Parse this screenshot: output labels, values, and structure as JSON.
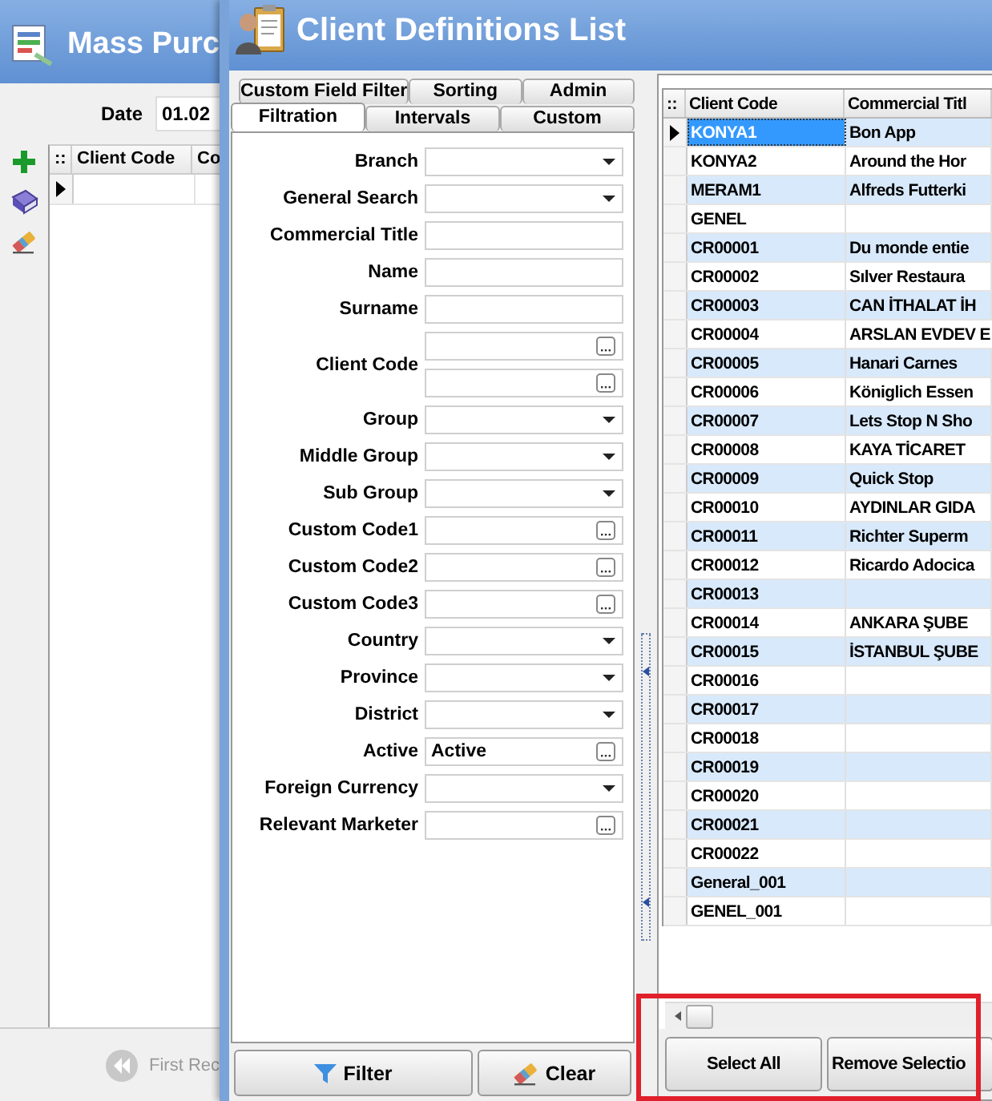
{
  "background_window": {
    "title": "Mass Purc",
    "date_label": "Date",
    "date_value": "01.02",
    "table": {
      "columns": [
        "::",
        "Client Code",
        "Co"
      ]
    },
    "status_bar": {
      "first_record": "First Rec",
      "disabled": true
    }
  },
  "window": {
    "title": "Client Definitions List"
  },
  "filter_tabs": {
    "top_row": [
      {
        "label": "Custom Field Filter",
        "selected": false
      },
      {
        "label": "Sorting",
        "selected": false
      },
      {
        "label": "Admin",
        "selected": false
      }
    ],
    "bottom_row": [
      {
        "label": "Filtration",
        "selected": true
      },
      {
        "label": "Intervals",
        "selected": false
      },
      {
        "label": "Custom",
        "selected": false
      }
    ]
  },
  "filter_fields": [
    {
      "label": "Branch",
      "kind": "dropdown"
    },
    {
      "label": "General Search",
      "kind": "dropdown"
    },
    {
      "label": "Commercial Title",
      "kind": "text"
    },
    {
      "label": "Name",
      "kind": "text"
    },
    {
      "label": "Surname",
      "kind": "text"
    },
    {
      "label": "Client Code",
      "kind": "lookup-range"
    },
    {
      "label": "Group",
      "kind": "dropdown"
    },
    {
      "label": "Middle Group",
      "kind": "dropdown"
    },
    {
      "label": "Sub Group",
      "kind": "dropdown"
    },
    {
      "label": "Custom Code1",
      "kind": "lookup"
    },
    {
      "label": "Custom Code2",
      "kind": "lookup"
    },
    {
      "label": "Custom Code3",
      "kind": "lookup"
    },
    {
      "label": "Country",
      "kind": "dropdown"
    },
    {
      "label": "Province",
      "kind": "dropdown"
    },
    {
      "label": "District",
      "kind": "dropdown"
    },
    {
      "label": "Active",
      "kind": "lookup",
      "value": "Active"
    },
    {
      "label": "Foreign Currency",
      "kind": "dropdown"
    },
    {
      "label": "Relevant Marketer",
      "kind": "lookup"
    }
  ],
  "filter_buttons": [
    {
      "label": "Filter",
      "kind": "filter"
    },
    {
      "label": "Clear",
      "kind": "clear"
    }
  ],
  "table": {
    "columns": [
      "::",
      "Client Code",
      "Commercial Titl"
    ],
    "rows": [
      {
        "code": "KONYA1",
        "title": "Bon App",
        "selected": true
      },
      {
        "code": "KONYA2",
        "title": "Around the Hor",
        "selected": false
      },
      {
        "code": "MERAM1",
        "title": "Alfreds Futterki",
        "selected": false
      },
      {
        "code": "GENEL",
        "selected": false
      },
      {
        "code": "CR00001",
        "title": "Du monde entie",
        "selected": false
      },
      {
        "code": "CR00002",
        "title": "Sılver Restaura",
        "selected": false
      },
      {
        "code": "CR00003",
        "title": "CAN İTHALAT İH",
        "selected": false
      },
      {
        "code": "CR00004",
        "title": "ARSLAN EVDEV E",
        "selected": false
      },
      {
        "code": "CR00005",
        "title": "Hanari Carnes",
        "selected": false
      },
      {
        "code": "CR00006",
        "title": "Königlich Essen",
        "selected": false
      },
      {
        "code": "CR00007",
        "title": "Lets Stop N Sho",
        "selected": false
      },
      {
        "code": "CR00008",
        "title": "KAYA TİCARET",
        "selected": false
      },
      {
        "code": "CR00009",
        "title": "Quick Stop",
        "selected": false
      },
      {
        "code": "CR00010",
        "title": "AYDINLAR GIDA",
        "selected": false
      },
      {
        "code": "CR00011",
        "title": "Richter Superm",
        "selected": false
      },
      {
        "code": "CR00012",
        "title": "Ricardo Adocica",
        "selected": false
      },
      {
        "code": "CR00013",
        "selected": false
      },
      {
        "code": "CR00014",
        "title": "ANKARA ŞUBE",
        "selected": false
      },
      {
        "code": "CR00015",
        "title": "İSTANBUL ŞUBE",
        "selected": false
      },
      {
        "code": "CR00016",
        "selected": false
      },
      {
        "code": "CR00017",
        "selected": false
      },
      {
        "code": "CR00018",
        "selected": false
      },
      {
        "code": "CR00019",
        "selected": false
      },
      {
        "code": "CR00020",
        "selected": false
      },
      {
        "code": "CR00021",
        "selected": false
      },
      {
        "code": "CR00022",
        "selected": false
      },
      {
        "code": "General_001",
        "selected": false
      },
      {
        "code": "GENEL_001",
        "selected": false
      }
    ]
  },
  "grid_buttons": [
    "Select All",
    "Remove Selectio"
  ],
  "annotation": {
    "kind": "highlight-frame"
  }
}
